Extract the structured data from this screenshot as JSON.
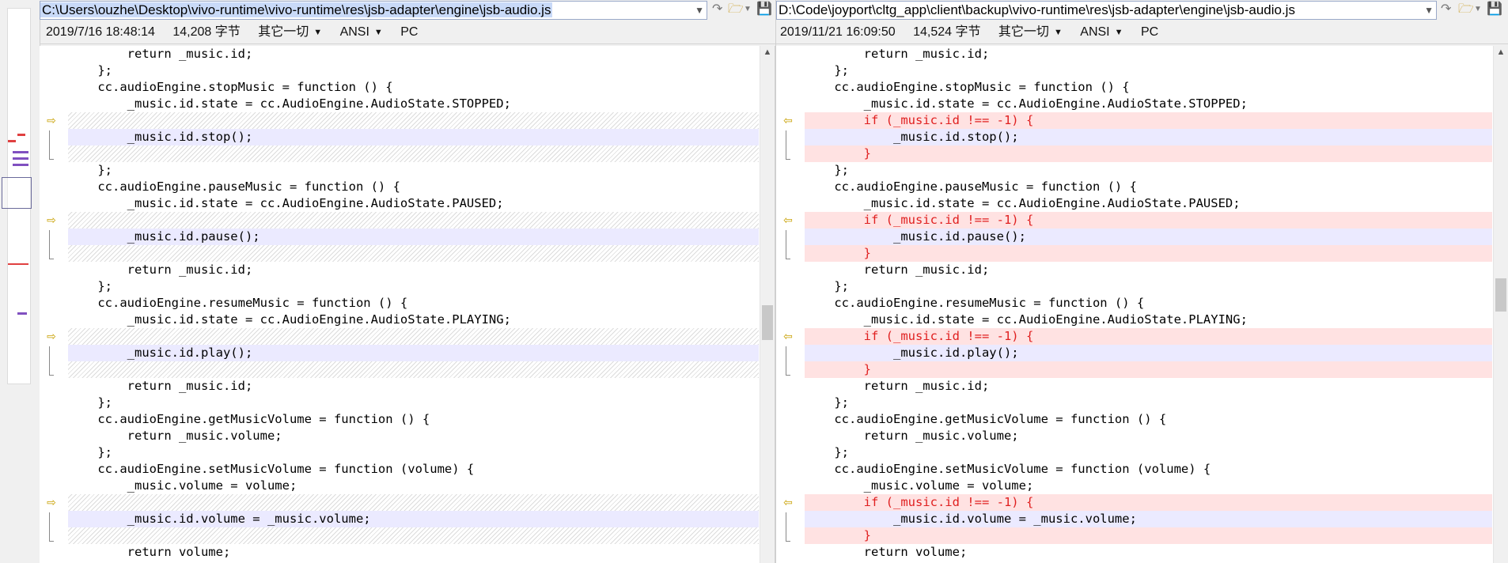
{
  "colors": {
    "deleted_text": "#e02020",
    "modified_bg": "#ebeaff",
    "inserted_bg": "#ffe2e2",
    "marker": "#c8a000",
    "path_selected_bg": "#c9daf8"
  },
  "left": {
    "path": "C:\\Users\\ouzhe\\Desktop\\vivo-runtime\\vivo-runtime\\res\\jsb-adapter\\engine\\jsb-audio.js",
    "info": {
      "timestamp": "2019/7/16 18:48:14",
      "size": "14,208 字节",
      "encoding_mode": "其它一切",
      "charset": "ANSI",
      "line_end": "PC"
    },
    "lines": [
      {
        "t": "        return _music.id;",
        "k": "n"
      },
      {
        "t": "    };",
        "k": "n"
      },
      {
        "t": "    cc.audioEngine.stopMusic = function () {",
        "k": "n"
      },
      {
        "t": "        _music.id.state = cc.AudioEngine.AudioState.STOPPED;",
        "k": "n"
      },
      {
        "t": "",
        "k": "gap"
      },
      {
        "t": "        _music.id.stop();",
        "k": "mod"
      },
      {
        "t": "",
        "k": "gap"
      },
      {
        "t": "    };",
        "k": "n"
      },
      {
        "t": "    cc.audioEngine.pauseMusic = function () {",
        "k": "n"
      },
      {
        "t": "        _music.id.state = cc.AudioEngine.AudioState.PAUSED;",
        "k": "n"
      },
      {
        "t": "",
        "k": "gap"
      },
      {
        "t": "        _music.id.pause();",
        "k": "mod"
      },
      {
        "t": "",
        "k": "gap"
      },
      {
        "t": "        return _music.id;",
        "k": "n"
      },
      {
        "t": "    };",
        "k": "n"
      },
      {
        "t": "    cc.audioEngine.resumeMusic = function () {",
        "k": "n"
      },
      {
        "t": "        _music.id.state = cc.AudioEngine.AudioState.PLAYING;",
        "k": "n"
      },
      {
        "t": "",
        "k": "gap"
      },
      {
        "t": "        _music.id.play();",
        "k": "mod"
      },
      {
        "t": "",
        "k": "gap"
      },
      {
        "t": "        return _music.id;",
        "k": "n"
      },
      {
        "t": "    };",
        "k": "n"
      },
      {
        "t": "    cc.audioEngine.getMusicVolume = function () {",
        "k": "n"
      },
      {
        "t": "        return _music.volume;",
        "k": "n"
      },
      {
        "t": "    };",
        "k": "n"
      },
      {
        "t": "    cc.audioEngine.setMusicVolume = function (volume) {",
        "k": "n"
      },
      {
        "t": "        _music.volume = volume;",
        "k": "n"
      },
      {
        "t": "",
        "k": "gap"
      },
      {
        "t": "        _music.id.volume = _music.volume;",
        "k": "mod"
      },
      {
        "t": "",
        "k": "gap"
      },
      {
        "t": "        return volume;",
        "k": "n"
      }
    ]
  },
  "right": {
    "path": "D:\\Code\\joyport\\cltg_app\\client\\backup\\vivo-runtime\\res\\jsb-adapter\\engine\\jsb-audio.js",
    "info": {
      "timestamp": "2019/11/21 16:09:50",
      "size": "14,524 字节",
      "encoding_mode": "其它一切",
      "charset": "ANSI",
      "line_end": "PC"
    },
    "lines": [
      {
        "t": "        return _music.id;",
        "k": "n"
      },
      {
        "t": "    };",
        "k": "n"
      },
      {
        "t": "    cc.audioEngine.stopMusic = function () {",
        "k": "n"
      },
      {
        "t": "        _music.id.state = cc.AudioEngine.AudioState.STOPPED;",
        "k": "n"
      },
      {
        "t": "        if (_music.id !== -1) {",
        "k": "ins"
      },
      {
        "t": "            _music.id.stop();",
        "k": "mod"
      },
      {
        "t": "        }",
        "k": "ins"
      },
      {
        "t": "    };",
        "k": "n"
      },
      {
        "t": "    cc.audioEngine.pauseMusic = function () {",
        "k": "n"
      },
      {
        "t": "        _music.id.state = cc.AudioEngine.AudioState.PAUSED;",
        "k": "n"
      },
      {
        "t": "        if (_music.id !== -1) {",
        "k": "ins"
      },
      {
        "t": "            _music.id.pause();",
        "k": "mod"
      },
      {
        "t": "        }",
        "k": "ins"
      },
      {
        "t": "        return _music.id;",
        "k": "n"
      },
      {
        "t": "    };",
        "k": "n"
      },
      {
        "t": "    cc.audioEngine.resumeMusic = function () {",
        "k": "n"
      },
      {
        "t": "        _music.id.state = cc.AudioEngine.AudioState.PLAYING;",
        "k": "n"
      },
      {
        "t": "        if (_music.id !== -1) {",
        "k": "ins"
      },
      {
        "t": "            _music.id.play();",
        "k": "mod"
      },
      {
        "t": "        }",
        "k": "ins"
      },
      {
        "t": "        return _music.id;",
        "k": "n"
      },
      {
        "t": "    };",
        "k": "n"
      },
      {
        "t": "    cc.audioEngine.getMusicVolume = function () {",
        "k": "n"
      },
      {
        "t": "        return _music.volume;",
        "k": "n"
      },
      {
        "t": "    };",
        "k": "n"
      },
      {
        "t": "    cc.audioEngine.setMusicVolume = function (volume) {",
        "k": "n"
      },
      {
        "t": "        _music.volume = volume;",
        "k": "n"
      },
      {
        "t": "        if (_music.id !== -1) {",
        "k": "ins"
      },
      {
        "t": "            _music.id.volume = _music.volume;",
        "k": "mod"
      },
      {
        "t": "        }",
        "k": "ins"
      },
      {
        "t": "        return volume;",
        "k": "n"
      }
    ]
  },
  "icons": {
    "dropdown": "chevron-down-icon",
    "open_folder": "folder-open-icon",
    "save": "save-icon",
    "diff_marker_left": "arrow-right-icon",
    "diff_marker_right": "arrow-left-icon",
    "scroll_up": "scroll-up-icon"
  }
}
